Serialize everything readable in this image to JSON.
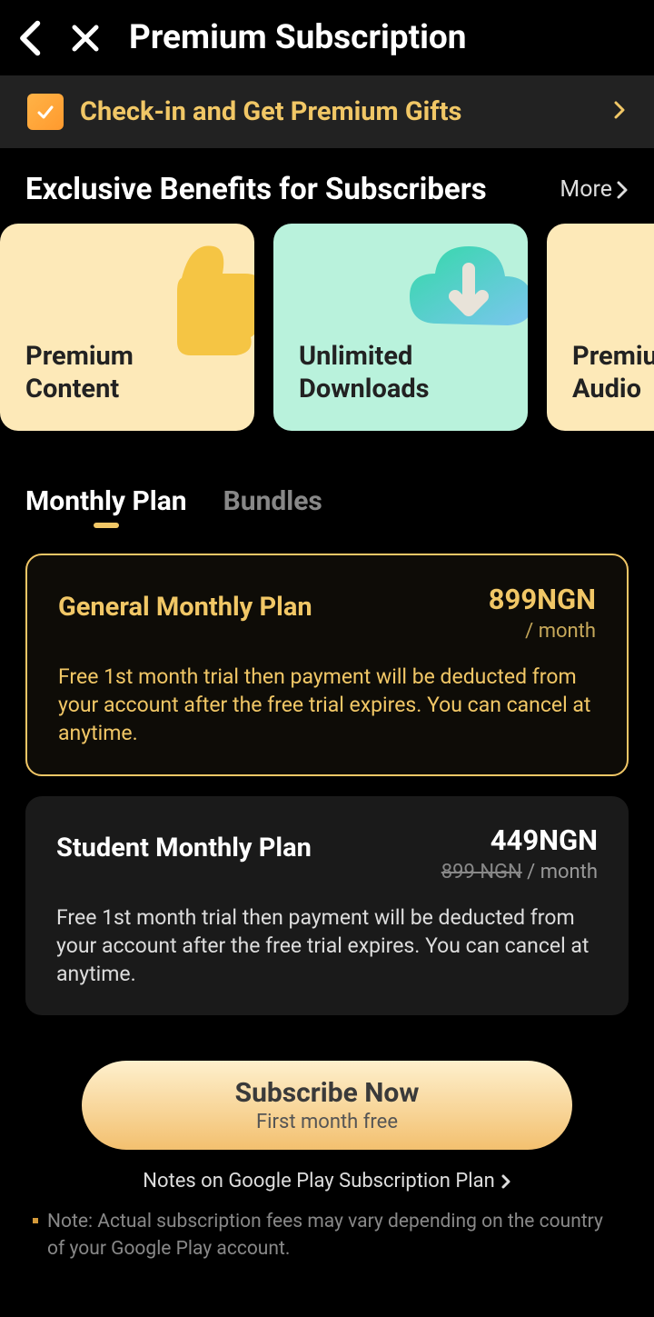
{
  "header": {
    "title": "Premium Subscription"
  },
  "banner": {
    "text": "Check-in and Get Premium Gifts"
  },
  "benefits": {
    "title": "Exclusive Benefits for Subscribers",
    "more": "More",
    "cards": [
      {
        "label": "Premium\nContent"
      },
      {
        "label": "Unlimited\nDownloads"
      },
      {
        "label": "Premium\nAudio"
      }
    ]
  },
  "tabs": {
    "monthly": "Monthly Plan",
    "bundles": "Bundles"
  },
  "plans": {
    "general": {
      "name": "General Monthly Plan",
      "price": "899NGN",
      "period": "/ month",
      "desc": "Free 1st month trial then payment will be deducted from your account after the free trial expires. You can cancel at anytime."
    },
    "student": {
      "name": "Student Monthly Plan",
      "price": "449NGN",
      "old_price": "899 NGN",
      "period": " / month",
      "desc": "Free 1st month trial then payment will be deducted from your account after the free trial expires. You can cancel at anytime."
    }
  },
  "cta": {
    "title": "Subscribe Now",
    "sub": "First month free"
  },
  "notes": {
    "link": "Notes on Google Play Subscription Plan",
    "foot": "Note: Actual subscription fees may vary depending on the country of your Google Play account."
  }
}
